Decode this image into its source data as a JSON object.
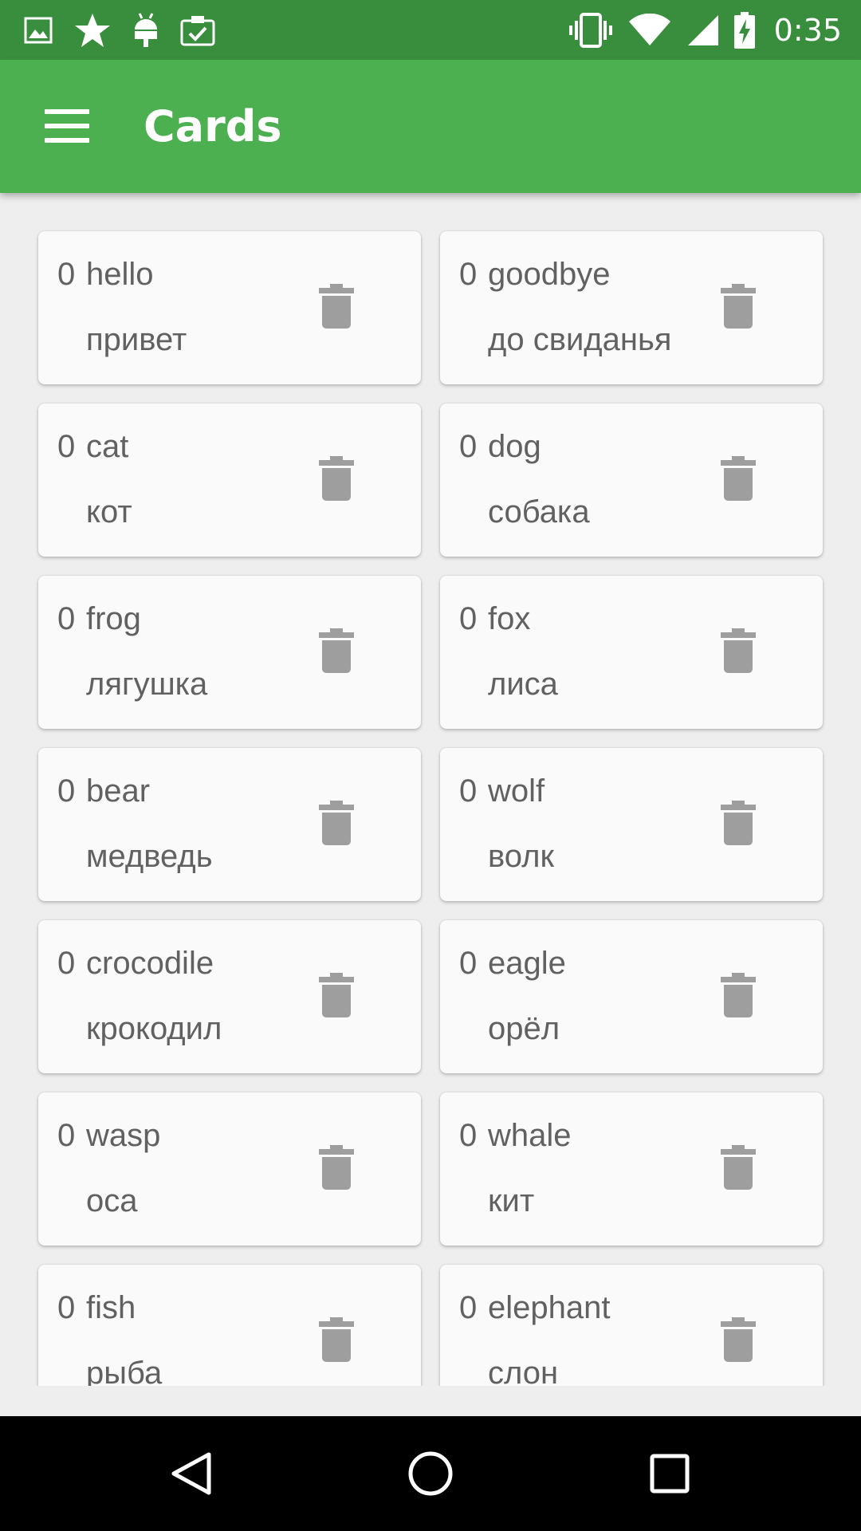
{
  "status_bar": {
    "time": "0:35",
    "left_icons": [
      "image-icon",
      "star-icon",
      "android-icon",
      "clipboard-check-icon"
    ],
    "right_icons": [
      "vibrate-icon",
      "wifi-icon",
      "cell-signal-icon",
      "battery-charging-icon"
    ]
  },
  "app_bar": {
    "title": "Cards",
    "menu_icon": "menu-icon",
    "color": "#4caf50",
    "status_color": "#388e3c"
  },
  "cards": [
    {
      "count": "0",
      "word": "hello",
      "translation": "привет"
    },
    {
      "count": "0",
      "word": "goodbye",
      "translation": "до свиданья"
    },
    {
      "count": "0",
      "word": "cat",
      "translation": "кот"
    },
    {
      "count": "0",
      "word": "dog",
      "translation": "собака"
    },
    {
      "count": "0",
      "word": "frog",
      "translation": "лягушка"
    },
    {
      "count": "0",
      "word": "fox",
      "translation": "лиса"
    },
    {
      "count": "0",
      "word": "bear",
      "translation": "медведь"
    },
    {
      "count": "0",
      "word": "wolf",
      "translation": "волк"
    },
    {
      "count": "0",
      "word": "crocodile",
      "translation": "крокодил"
    },
    {
      "count": "0",
      "word": "eagle",
      "translation": "орёл"
    },
    {
      "count": "0",
      "word": "wasp",
      "translation": "оса"
    },
    {
      "count": "0",
      "word": "whale",
      "translation": "кит"
    },
    {
      "count": "0",
      "word": "fish",
      "translation": "рыба"
    },
    {
      "count": "0",
      "word": "elephant",
      "translation": "слон"
    }
  ],
  "card_icon": "trash-icon",
  "nav_bar": {
    "buttons": [
      "back-icon",
      "home-icon",
      "recents-icon"
    ]
  }
}
